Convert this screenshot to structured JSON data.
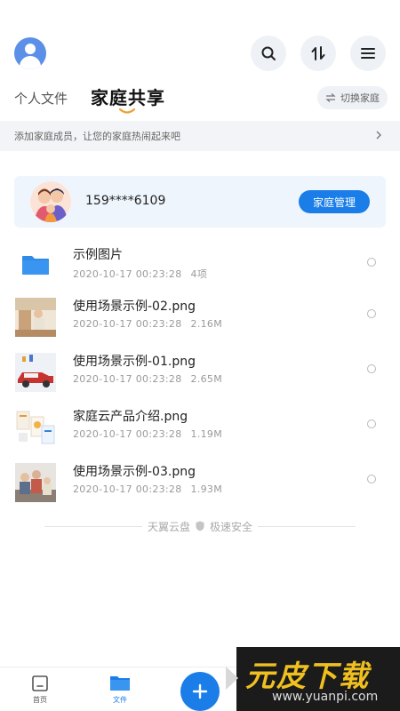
{
  "header": {
    "avatar_icon": "user-avatar-icon",
    "buttons": [
      "search-icon",
      "sort-icon",
      "menu-icon"
    ]
  },
  "tabs": {
    "personal": "个人文件",
    "family": "家庭共享",
    "switch_label": "切换家庭"
  },
  "notice": {
    "text": "添加家庭成员，让您的家庭热闹起来吧"
  },
  "family_card": {
    "phone": "159****6109",
    "manage_label": "家庭管理"
  },
  "files": [
    {
      "name": "示例图片",
      "date": "2020-10-17 00:23:28",
      "info": "4项",
      "type": "folder"
    },
    {
      "name": "使用场景示例-02.png",
      "date": "2020-10-17 00:23:28",
      "info": "2.16M",
      "type": "image"
    },
    {
      "name": "使用场景示例-01.png",
      "date": "2020-10-17 00:23:28",
      "info": "2.65M",
      "type": "image"
    },
    {
      "name": "家庭云产品介绍.png",
      "date": "2020-10-17 00:23:28",
      "info": "1.19M",
      "type": "image"
    },
    {
      "name": "使用场景示例-03.png",
      "date": "2020-10-17 00:23:28",
      "info": "1.93M",
      "type": "image"
    }
  ],
  "footer": {
    "brand": "天翼云盘",
    "slogan": "极速安全"
  },
  "bottom_nav": {
    "home": "首页",
    "files": "文件"
  },
  "watermark": {
    "main": "元皮下载",
    "sub": "www.yuanpi.com"
  },
  "colors": {
    "accent": "#1a7de8",
    "card_bg": "#eef5fd"
  }
}
